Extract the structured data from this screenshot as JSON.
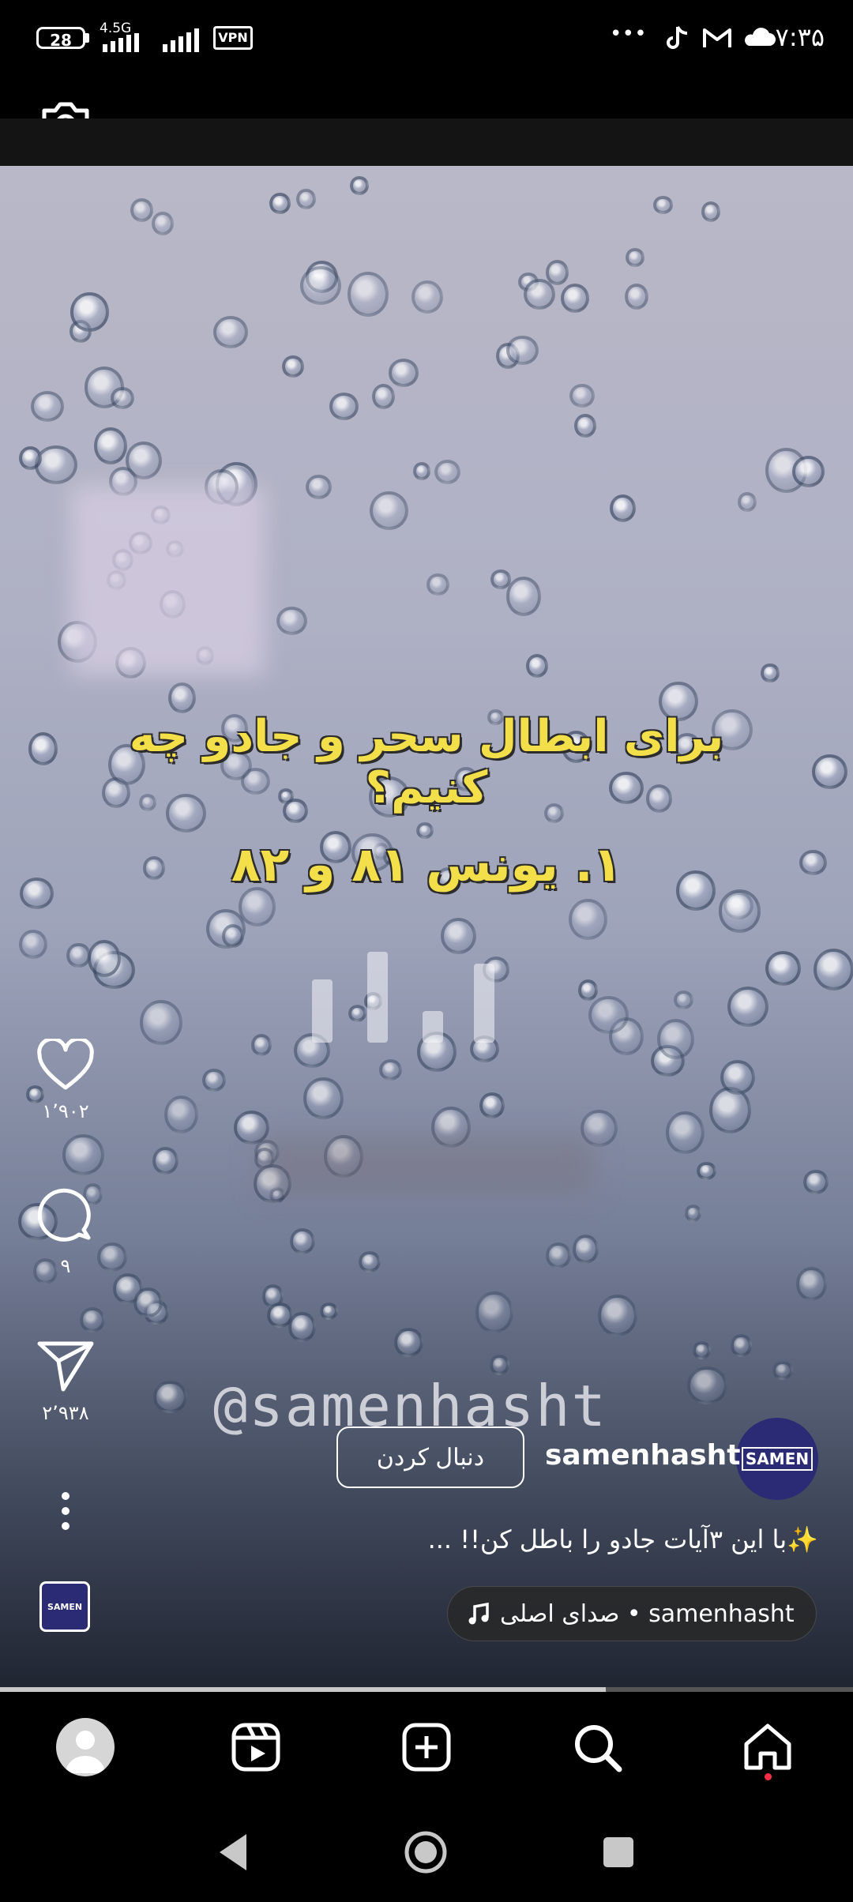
{
  "status_bar": {
    "battery": "28",
    "network": "4.5G",
    "vpn": "VPN",
    "time": "۷:۳۵",
    "overflow": "• • •"
  },
  "video": {
    "overlay_title": "برای ابطال سحر و جادو چه کنیم؟",
    "overlay_verse": "۱. یونس ۸۱ و ۸۲",
    "watermark": "@samenhasht"
  },
  "actions": {
    "likes": "۱٬۹۰۲",
    "comments": "۹",
    "shares": "۲٬۹۳۸"
  },
  "post": {
    "avatar_text": "SAMEN",
    "username": "samenhasht",
    "follow_label": "دنبال کردن",
    "caption": "✨با این ۳آیات جادو را باطل کن!! ...",
    "audio": "samenhasht • صدای اصلی",
    "audio_avatar_text": "SAMEN"
  },
  "playback": {
    "progress": 0.71
  },
  "bottom_nav": {
    "items": [
      "profile",
      "reels",
      "create",
      "search",
      "home"
    ],
    "active": "home"
  },
  "colors": {
    "overlay_text": "#f3df4a",
    "avatar_bg": "#2a2a75",
    "notification_dot": "#ff2d45"
  }
}
